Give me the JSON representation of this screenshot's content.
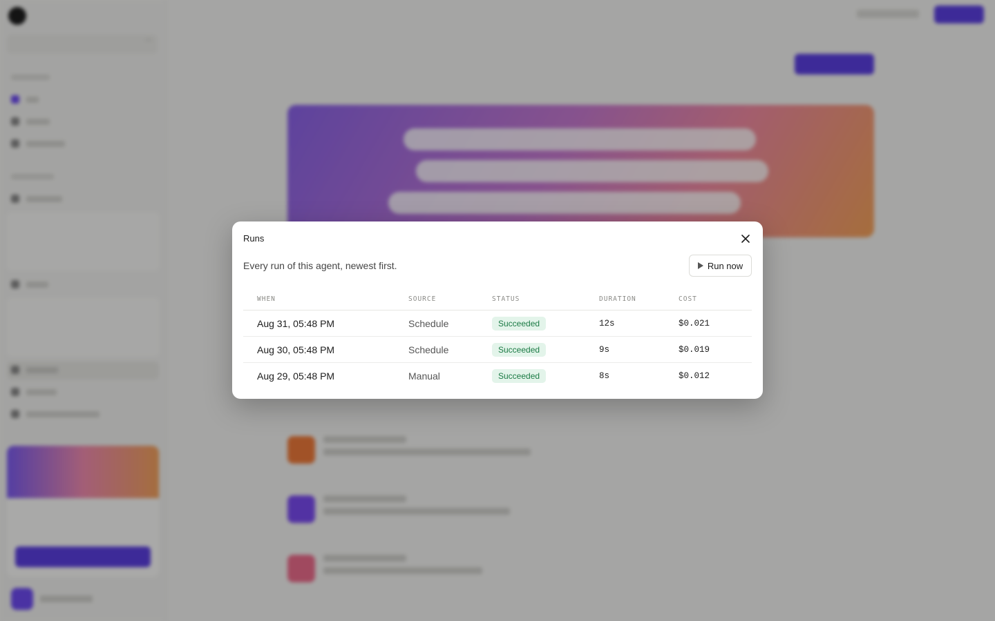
{
  "background": {
    "sidebar": {
      "workspace": "",
      "search_placeholder": "",
      "items": []
    },
    "main": {
      "title": "",
      "subtitle": ""
    }
  },
  "modal": {
    "title": "Runs",
    "description": "Every run of this agent, newest first.",
    "run_now_label": "Run now",
    "columns": [
      "WHEN",
      "SOURCE",
      "STATUS",
      "DURATION",
      "COST"
    ],
    "rows": [
      {
        "when": "Aug 31, 05:48 PM",
        "source": "Schedule",
        "status": "Succeeded",
        "duration": "12s",
        "cost": "$0.021"
      },
      {
        "when": "Aug 30, 05:48 PM",
        "source": "Schedule",
        "status": "Succeeded",
        "duration": "9s",
        "cost": "$0.019"
      },
      {
        "when": "Aug 29, 05:48 PM",
        "source": "Manual",
        "status": "Succeeded",
        "duration": "8s",
        "cost": "$0.012"
      }
    ]
  },
  "colors": {
    "accent": "#5b3fe0",
    "success_bg": "#e3f4ea",
    "success_text": "#1a7a44"
  },
  "icons": {
    "close": "close-icon",
    "run": "play-icon"
  }
}
